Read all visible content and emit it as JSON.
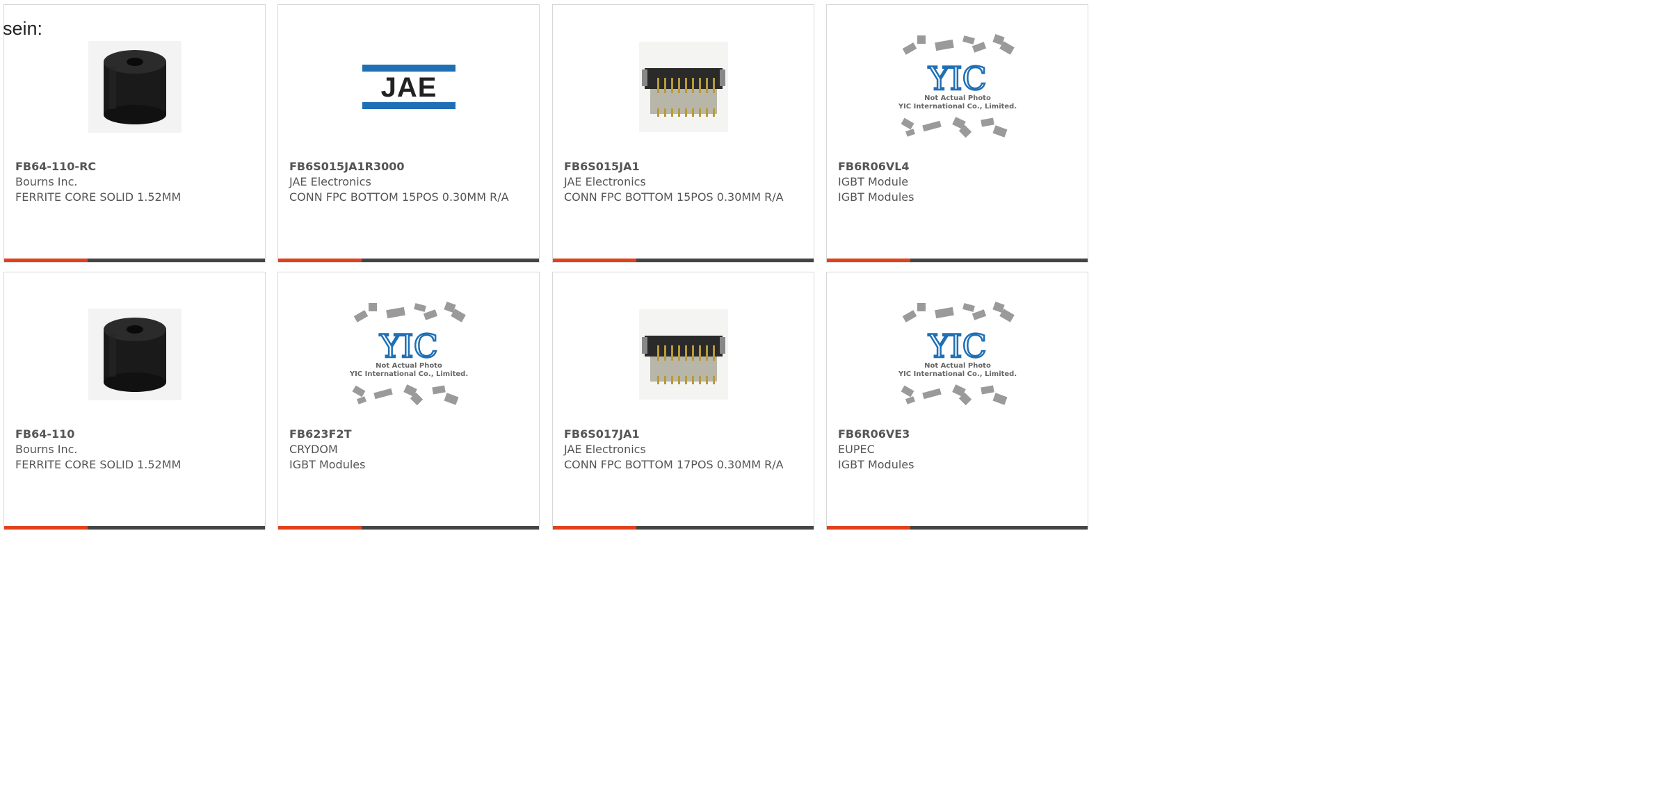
{
  "stray_text": "sein:",
  "colors": {
    "accent": "#e0411b",
    "bar": "#444444",
    "text": "#555555",
    "jae_blue": "#1f6fb5"
  },
  "products": [
    {
      "part": "FB64-110-RC",
      "maker": "Bourns Inc.",
      "desc": "FERRITE CORE SOLID 1.52MM",
      "image": "ferrite-core"
    },
    {
      "part": "FB6S015JA1R3000",
      "maker": "JAE Electronics",
      "desc": "CONN FPC BOTTOM 15POS 0.30MM R/A",
      "image": "jae-logo",
      "logo_text": "JAE"
    },
    {
      "part": "FB6S015JA1",
      "maker": "JAE Electronics",
      "desc": "CONN FPC BOTTOM 15POS 0.30MM R/A",
      "image": "fpc-connector"
    },
    {
      "part": "FB6R06VL4",
      "maker": "IGBT Module",
      "desc": "IGBT Modules",
      "image": "yic-placeholder"
    },
    {
      "part": "FB64-110",
      "maker": "Bourns Inc.",
      "desc": "FERRITE CORE SOLID 1.52MM",
      "image": "ferrite-core"
    },
    {
      "part": "FB623F2T",
      "maker": "CRYDOM",
      "desc": "IGBT Modules",
      "image": "yic-placeholder"
    },
    {
      "part": "FB6S017JA1",
      "maker": "JAE Electronics",
      "desc": "CONN FPC BOTTOM 17POS 0.30MM R/A",
      "image": "fpc-connector"
    },
    {
      "part": "FB6R06VE3",
      "maker": "EUPEC",
      "desc": "IGBT Modules",
      "image": "yic-placeholder"
    }
  ],
  "placeholder": {
    "line1": "Not Actual Photo",
    "line2": "YIC International Co., Limited.",
    "logo": "YIC"
  }
}
